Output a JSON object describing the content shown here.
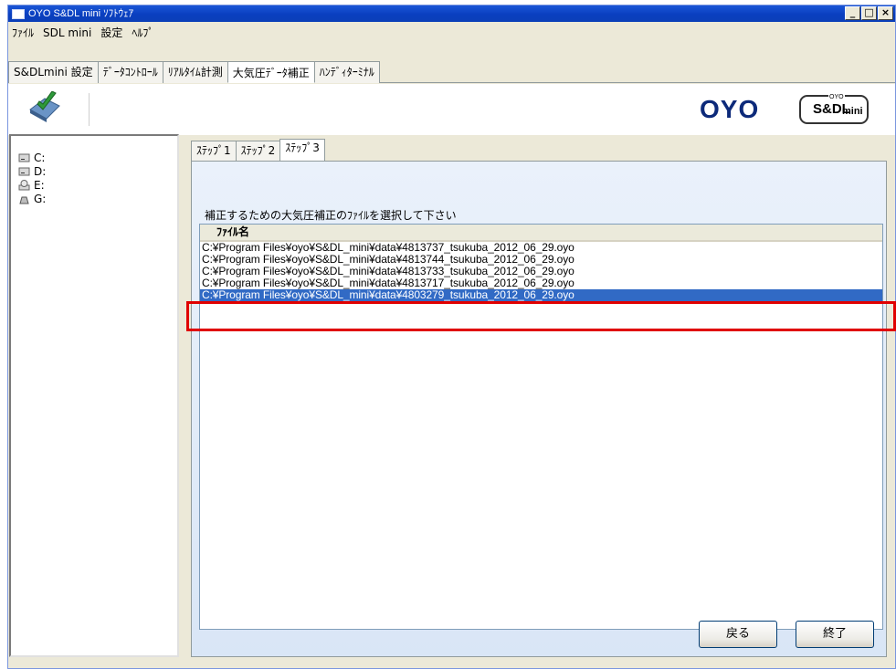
{
  "window": {
    "title": "OYO S&DL mini ｿﾌﾄｳｪｱ"
  },
  "title_buttons": [
    "_",
    "□",
    "×"
  ],
  "menu": [
    "ﾌｧｲﾙ",
    "SDL mini",
    "設定",
    "ﾍﾙﾌﾟ"
  ],
  "app_tabs": [
    "S&DLmini 設定",
    "ﾃﾞｰﾀｺﾝﾄﾛｰﾙ",
    "ﾘｱﾙﾀｲﾑ計測",
    "大気圧ﾃﾞｰﾀ補正",
    "ﾊﾝﾃﾞｨﾀｰﾐﾅﾙ"
  ],
  "active_app_tab": "大気圧ﾃﾞｰﾀ補正",
  "logo": {
    "brand": "OYO",
    "badge_main": "S&DL",
    "badge_sub": "mini",
    "badge_top": "OYO"
  },
  "drives": [
    "C:",
    "D:",
    "E:",
    "G:"
  ],
  "step_tabs": [
    "ｽﾃｯﾌﾟ1",
    "ｽﾃｯﾌﾟ2",
    "ｽﾃｯﾌﾟ3"
  ],
  "active_step_tab": "ｽﾃｯﾌﾟ3",
  "instruction": "補正するための大気圧補正のﾌｧｲﾙを選択して下さい",
  "file_list": {
    "header": "ﾌｧｲﾙ名",
    "rows": [
      "C:¥Program Files¥oyo¥S&DL_mini¥data¥4813737_tsukuba_2012_06_29.oyo",
      "C:¥Program Files¥oyo¥S&DL_mini¥data¥4813744_tsukuba_2012_06_29.oyo",
      "C:¥Program Files¥oyo¥S&DL_mini¥data¥4813733_tsukuba_2012_06_29.oyo",
      "C:¥Program Files¥oyo¥S&DL_mini¥data¥4813717_tsukuba_2012_06_29.oyo",
      "C:¥Program Files¥oyo¥S&DL_mini¥data¥4803279_tsukuba_2012_06_29.oyo"
    ],
    "selected_index": 4
  },
  "buttons": {
    "back": "戻る",
    "exit": "終了"
  },
  "colors": {
    "selection": "#316ac5",
    "highlight_box": "#e00000",
    "titlebar": "#0a3fc0"
  }
}
